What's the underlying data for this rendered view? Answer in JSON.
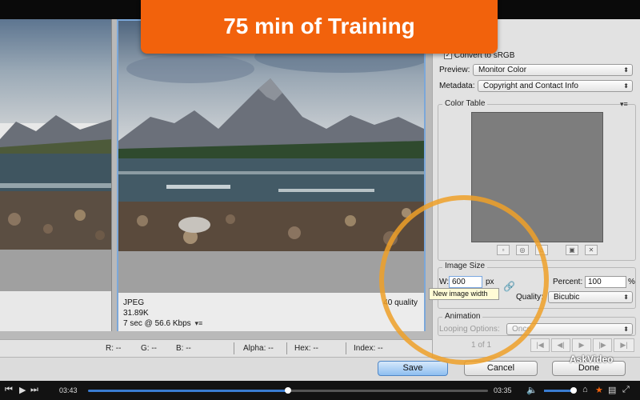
{
  "banner": {
    "text": "75 min of Training"
  },
  "settings": {
    "convert_label": "Convert to sRGB",
    "preview_label": "Preview:",
    "preview_value": "Monitor Color",
    "metadata_label": "Metadata:",
    "metadata_value": "Copyright and Contact Info",
    "color_table_title": "Color Table"
  },
  "image_size": {
    "title": "Image Size",
    "w_label": "W:",
    "w_value": "600",
    "w_unit": "px",
    "tooltip": "New image width",
    "percent_label": "Percent:",
    "percent_value": "100",
    "percent_unit": "%",
    "quality_label": "Quality:",
    "quality_value": "Bicubic"
  },
  "animation": {
    "title": "Animation",
    "looping_label": "Looping Options:",
    "looping_value": "Once",
    "frame_counter": "1 of 1"
  },
  "pane_info": {
    "format": "JPEG",
    "size": "31.89K",
    "time": "7 sec @ 56.6 Kbps",
    "quality": "40 quality"
  },
  "status": {
    "r": "R: --",
    "g": "G: --",
    "b": "B: --",
    "alpha": "Alpha: --",
    "hex": "Hex: --",
    "index": "Index: --"
  },
  "buttons": {
    "save": "Save",
    "cancel": "Cancel",
    "done": "Done"
  },
  "player": {
    "elapsed": "03:43",
    "remaining": "03:35",
    "progress": 0.5
  },
  "watermark": "AskVideo",
  "colors": {
    "banner": "#f2620c",
    "highlight_circle": "#eea028",
    "accent": "#3a7cd1"
  }
}
